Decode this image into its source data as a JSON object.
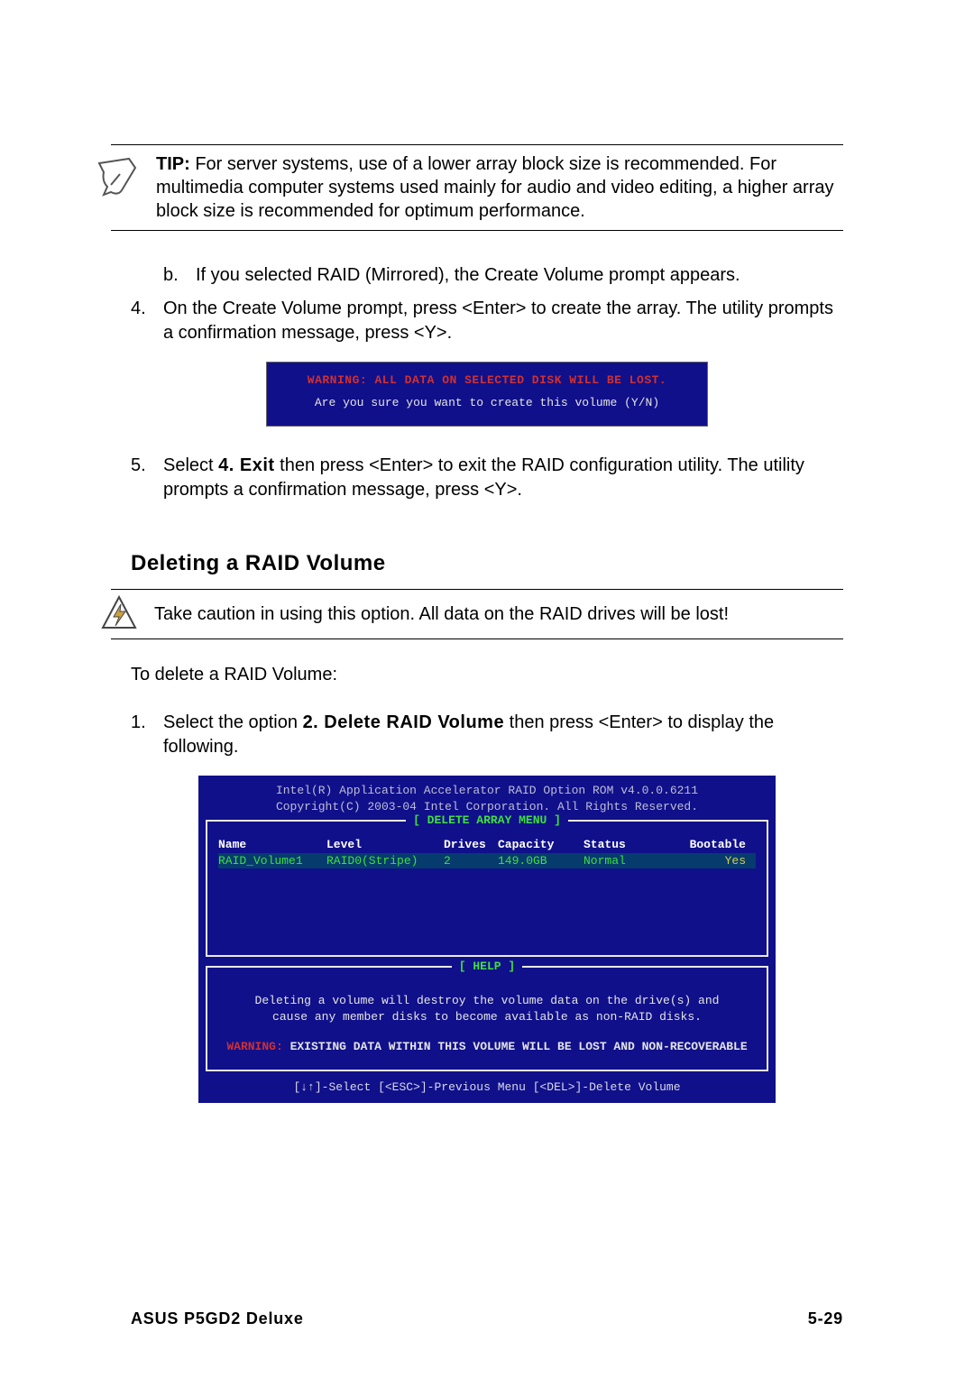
{
  "tip": {
    "label": "TIP:",
    "text": " For server systems, use of a lower array block size is recommended. For multimedia computer systems used mainly for audio and video editing, a higher array block size is recommended for optimum performance."
  },
  "items": {
    "b_letter": "b.",
    "b_text": "If you selected RAID (Mirrored), the Create Volume prompt appears.",
    "i4_num": "4.",
    "i4_text": "On the Create Volume prompt, press <Enter> to create the array. The utility prompts a confirmation message, press <Y>.",
    "i5_num": "5.",
    "i5_a": "Select ",
    "i5_bold": "4. Exit",
    "i5_b": " then press <Enter> to exit the RAID configuration utility. The utility prompts a confirmation message, press <Y>.",
    "i1_num": "1.",
    "i1_a": "Select the option ",
    "i1_bold": "2. Delete RAID Volume",
    "i1_b": " then press <Enter> to display the following."
  },
  "confirm_box": {
    "warn": "WARNING:  ALL DATA ON SELECTED DISK WILL BE LOST.",
    "q": "Are you sure you want to create this volume (Y/N)"
  },
  "section_heading": "Deleting a RAID Volume",
  "caution": "Take caution in using this option. All data on the RAID drives will be lost!",
  "intro_delete": "To delete a RAID Volume:",
  "bios": {
    "header1": "Intel(R) Application Accelerator RAID Option ROM v4.0.0.6211",
    "header2": "Copyright(C) 2003-04 Intel Corporation. All Rights Reserved.",
    "menu_title": "[ DELETE ARRAY MENU ]",
    "cols": {
      "name": "Name",
      "level": "Level",
      "drives": "Drives",
      "capacity": "Capacity",
      "status": "Status",
      "bootable": "Bootable"
    },
    "row": {
      "name": "RAID_Volume1",
      "level": "RAID0(Stripe)",
      "drives": "2",
      "capacity": "149.0GB",
      "status": "Normal",
      "bootable": "Yes"
    },
    "help_title": "[ HELP ]",
    "help_l1": "Deleting a volume will destroy the volume data on the drive(s) and",
    "help_l2": "cause any member disks to become available as non-RAID disks.",
    "help_warn_label": "WARNING:",
    "help_warn_text": " EXISTING DATA WITHIN THIS VOLUME WILL BE LOST AND NON-RECOVERABLE",
    "footer": "[↓↑]-Select    [<ESC>]-Previous Menu   [<DEL>]-Delete Volume"
  },
  "footer": {
    "left": "ASUS P5GD2 Deluxe",
    "right": "5-29"
  }
}
